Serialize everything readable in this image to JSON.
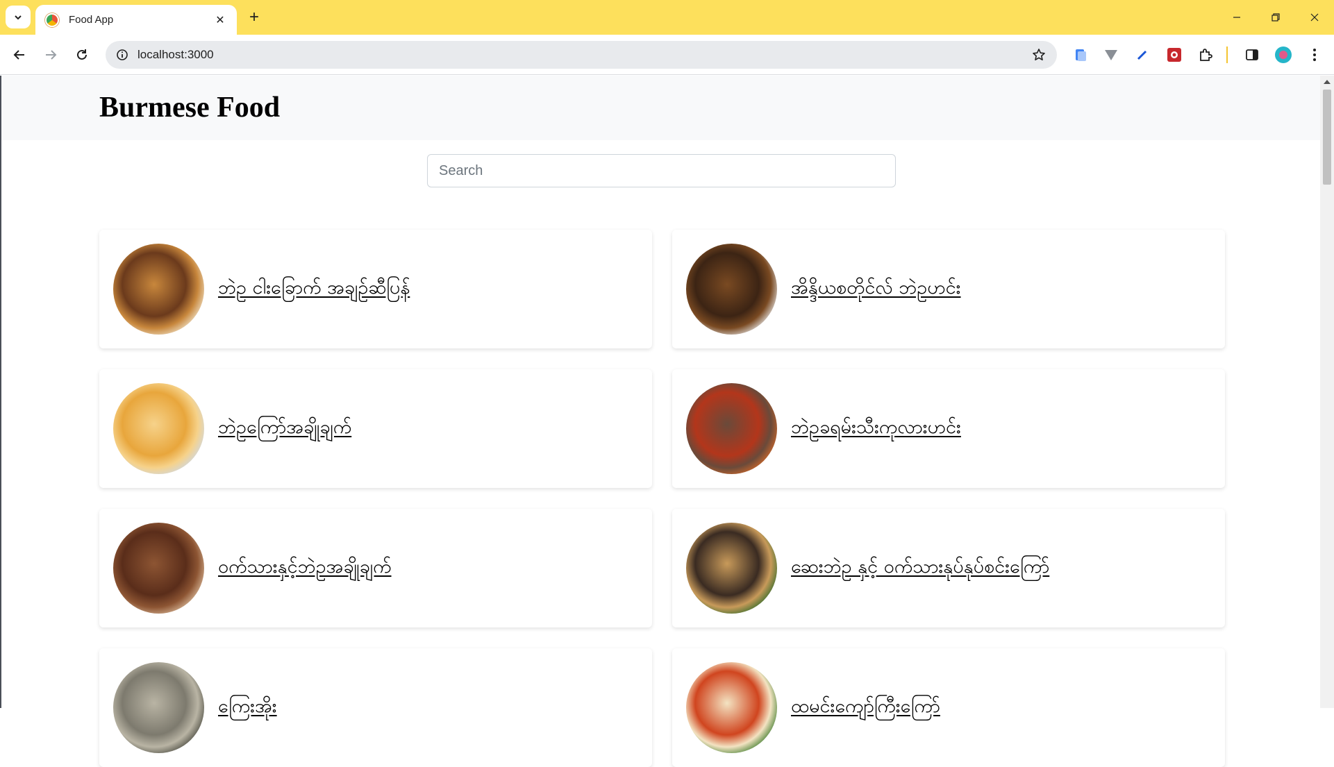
{
  "browser": {
    "tab_title": "Food App",
    "url": "localhost:3000",
    "tab_close_glyph": "✕",
    "new_tab_glyph": "+"
  },
  "page": {
    "brand": "Burmese Food",
    "search_placeholder": "Search",
    "search_value": ""
  },
  "foods": [
    {
      "name": "ဘဲဥ ငါးခြောက် အချဉ်ဆီပြန်",
      "thumb_colors": [
        "#6b3a1c",
        "#c8873c",
        "#f0e2c8"
      ]
    },
    {
      "name": "အိန္ဒိယစတိုင်လ် ဘဲဥဟင်း",
      "thumb_colors": [
        "#3c2414",
        "#7a4a22",
        "#e6e6e6"
      ]
    },
    {
      "name": "ဘဲဥကြော်အချိုချက်",
      "thumb_colors": [
        "#e8a63c",
        "#f6d28a",
        "#cfd8e3"
      ]
    },
    {
      "name": "ဘဲဥခရမ်းသီးကုလားဟင်း",
      "thumb_colors": [
        "#b3361b",
        "#6a4a3a",
        "#d46a2a"
      ]
    },
    {
      "name": "ဝက်သားနှင့်ဘဲဥအချိုချက်",
      "thumb_colors": [
        "#5a2d1a",
        "#8d5533",
        "#d9b99a"
      ]
    },
    {
      "name": "ဆေးဘဲဥ နှင့် ဝက်သားနုပ်နုပ်စင်းကြော်",
      "thumb_colors": [
        "#3a2b22",
        "#c89a5a",
        "#2f6b2a"
      ]
    },
    {
      "name": "ကြေးအိုး",
      "thumb_colors": [
        "#7d7a6e",
        "#b9b4a4",
        "#4a4a40"
      ]
    },
    {
      "name": "ထမင်းကျော်ကြီးကြော်",
      "thumb_colors": [
        "#d0451f",
        "#f3e3c2",
        "#3a7a2a"
      ]
    }
  ]
}
